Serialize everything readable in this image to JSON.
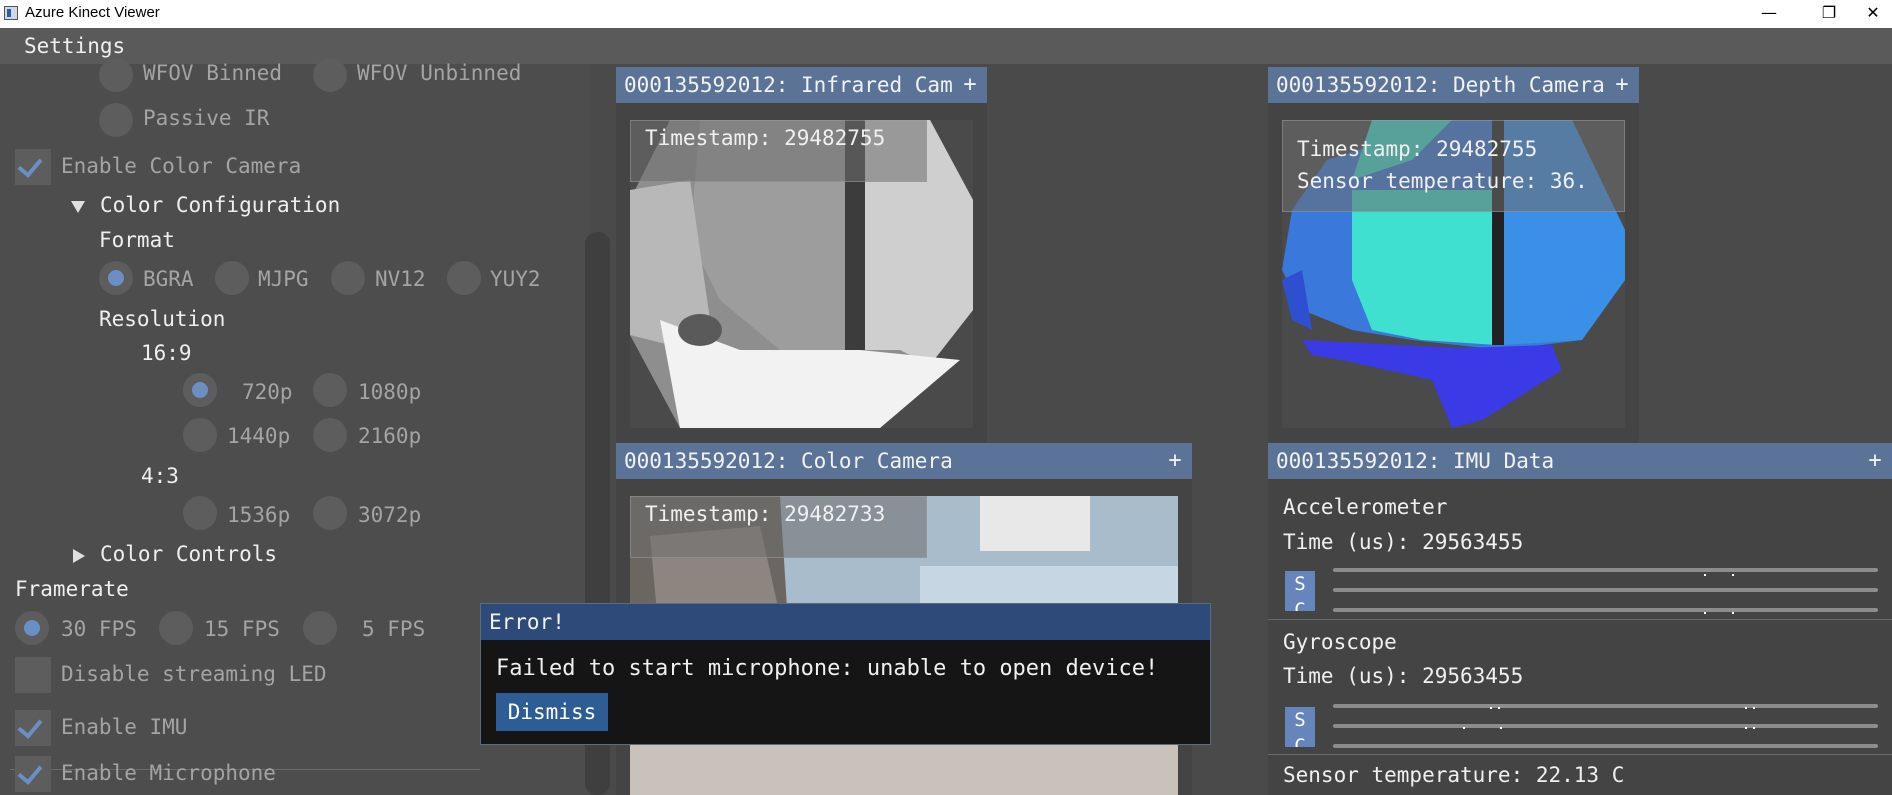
{
  "window": {
    "title": "Azure Kinect Viewer",
    "minimize": "—",
    "restore": "❐",
    "close": "✕"
  },
  "menu": {
    "settings": "Settings"
  },
  "sidebar": {
    "depth_modes": [
      "WFOV Binned",
      "WFOV Unbinned",
      "Passive IR"
    ],
    "enable_color_camera": "Enable Color Camera",
    "color_configuration": "Color Configuration",
    "format_label": "Format",
    "formats": [
      "BGRA",
      "MJPG",
      "NV12",
      "YUY2"
    ],
    "selected_format": "BGRA",
    "resolution_label": "Resolution",
    "aspect_16_9": "16:9",
    "res_16_9": [
      "720p",
      "1080p",
      "1440p",
      "2160p"
    ],
    "selected_resolution": "720p",
    "aspect_4_3": "4:3",
    "res_4_3": [
      "1536p",
      "3072p"
    ],
    "color_controls": "Color Controls",
    "framerate_label": "Framerate",
    "framerates": [
      "30 FPS",
      "15 FPS",
      "5 FPS"
    ],
    "selected_framerate": "30 FPS",
    "disable_led": "Disable streaming LED",
    "enable_imu": "Enable IMU",
    "enable_microphone": "Enable Microphone"
  },
  "panes": {
    "infrared": {
      "title": "000135592012: Infrared Camera",
      "plus": "+",
      "timestamp": "Timestamp: 29482755"
    },
    "depth": {
      "title": "000135592012: Depth Camera",
      "plus": "+",
      "timestamp": "Timestamp: 29482755",
      "sensor_temp": "Sensor temperature: 36."
    },
    "color": {
      "title": "000135592012: Color Camera",
      "plus": "+",
      "timestamp": "Timestamp: 29482733"
    },
    "imu": {
      "title": "000135592012: IMU Data",
      "plus": "+",
      "accel_label": "Accelerometer",
      "accel_time": "Time (us): 29563455",
      "gyro_label": "Gyroscope",
      "gyro_time": "Time (us): 29563455",
      "s_button": "S C",
      "sensor_temperature": "Sensor temperature: 22.13 C"
    }
  },
  "error_dialog": {
    "title": "Error!",
    "message": "Failed to start microphone: unable to open device!",
    "dismiss": "Dismiss"
  },
  "colors": {
    "accent": "#5b7396",
    "selected": "#6b8fc4",
    "dialog_title": "#2e4a78"
  }
}
